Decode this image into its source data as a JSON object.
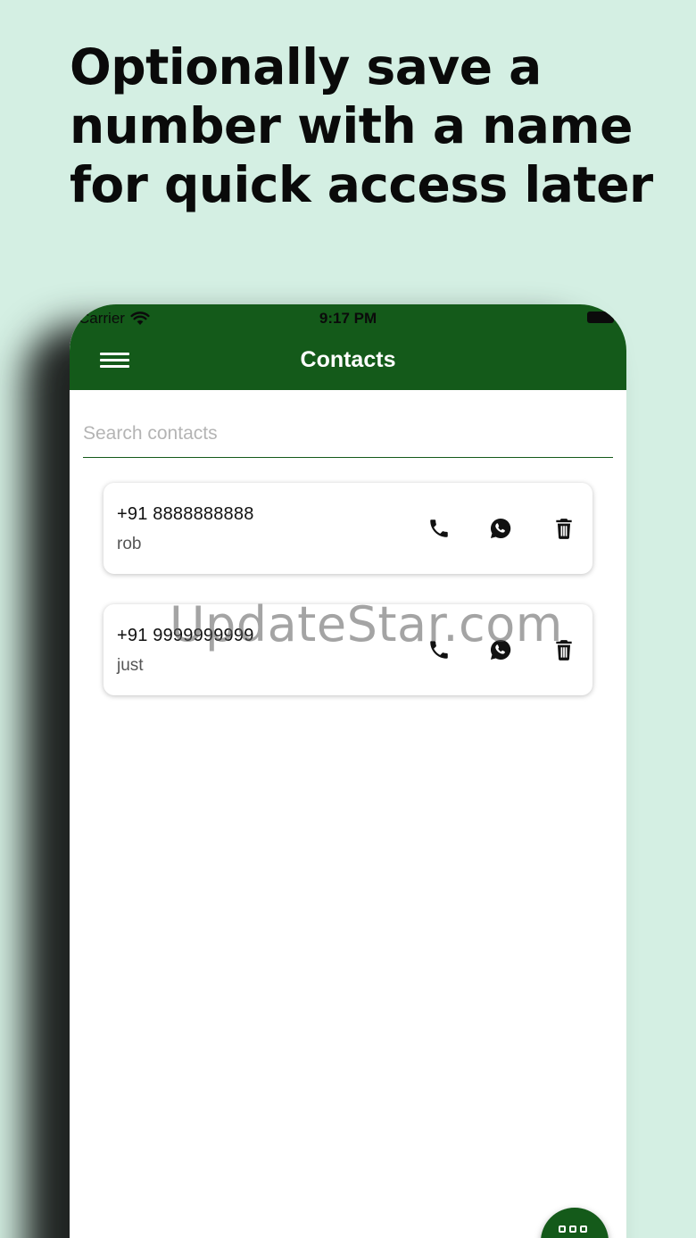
{
  "headline": {
    "lines": [
      "Optionally save a",
      "number with a name",
      "for quick access later"
    ]
  },
  "status_bar": {
    "carrier": "Carrier",
    "time": "9:17 PM"
  },
  "app_bar": {
    "title": "Contacts"
  },
  "search": {
    "placeholder": "Search contacts",
    "value": ""
  },
  "contacts": [
    {
      "number": "+91 8888888888",
      "name": "rob"
    },
    {
      "number": "+91 9999999999",
      "name": "just"
    }
  ],
  "watermark": "UpdateStar.com",
  "colors": {
    "background": "#d4efe3",
    "app_bar": "#145a1a",
    "card": "#ffffff"
  },
  "icons": {
    "menu": "hamburger-icon",
    "call": "phone-icon",
    "whatsapp": "whatsapp-icon",
    "delete": "trash-icon",
    "fab": "dialpad-icon"
  }
}
